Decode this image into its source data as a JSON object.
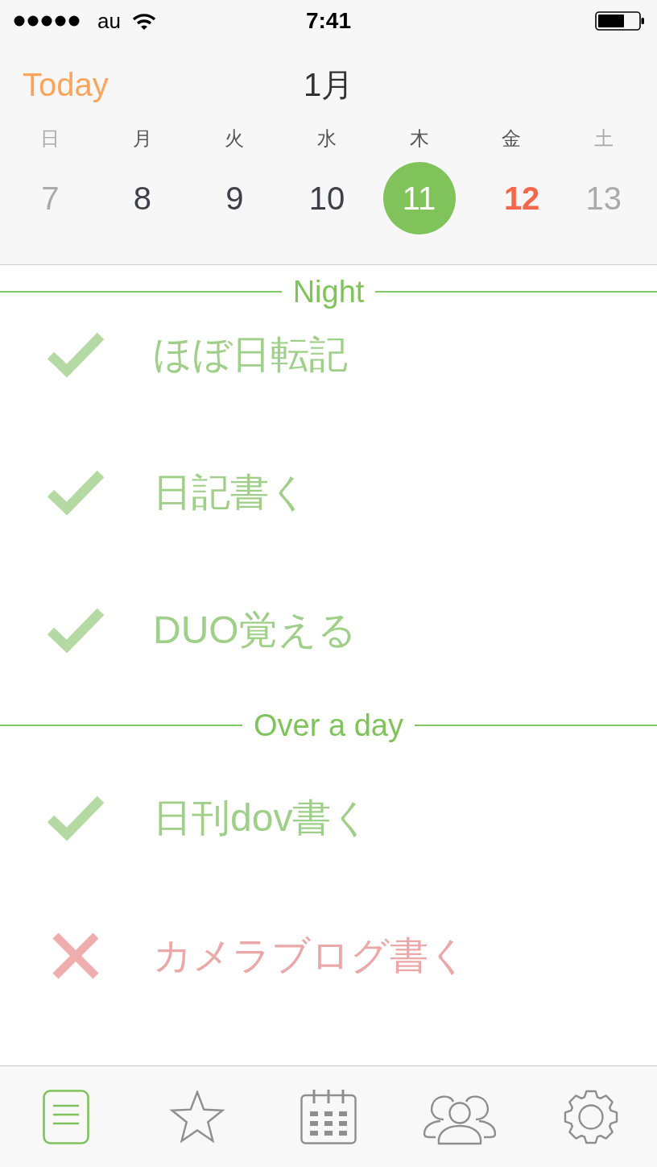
{
  "status_bar": {
    "carrier": "au",
    "time": "7:41"
  },
  "header": {
    "today_button": "Today",
    "month": "1月"
  },
  "calendar": {
    "days": [
      {
        "weekday": "日",
        "date": "7",
        "weekend": true,
        "today": false,
        "selected": false
      },
      {
        "weekday": "月",
        "date": "8",
        "weekend": false,
        "today": false,
        "selected": false
      },
      {
        "weekday": "火",
        "date": "9",
        "weekend": false,
        "today": false,
        "selected": false
      },
      {
        "weekday": "水",
        "date": "10",
        "weekend": false,
        "today": false,
        "selected": false
      },
      {
        "weekday": "木",
        "date": "11",
        "weekend": false,
        "today": false,
        "selected": true
      },
      {
        "weekday": "金",
        "date": "12",
        "weekend": false,
        "today": true,
        "selected": false
      },
      {
        "weekday": "土",
        "date": "13",
        "weekend": true,
        "today": false,
        "selected": false
      }
    ]
  },
  "sections": [
    {
      "title": "Night",
      "tasks": [
        {
          "title": "ほぼ日転記",
          "done": true
        },
        {
          "title": "日記書く",
          "done": true
        },
        {
          "title": "DUO覚える",
          "done": true
        }
      ]
    },
    {
      "title": "Over a day",
      "tasks": [
        {
          "title": "日刊dov書く",
          "done": true
        },
        {
          "title": "カメラブログ書く",
          "done": false
        }
      ]
    }
  ],
  "tab_bar": {
    "tabs": [
      {
        "kind": "list",
        "selected": true
      },
      {
        "kind": "star",
        "selected": false
      },
      {
        "kind": "calendar",
        "selected": false
      },
      {
        "kind": "people",
        "selected": false
      },
      {
        "kind": "settings",
        "selected": false
      }
    ]
  }
}
